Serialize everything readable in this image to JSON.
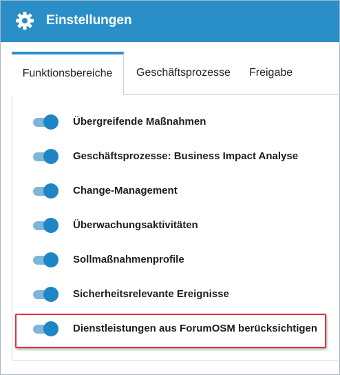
{
  "header": {
    "title": "Einstellungen",
    "icon": "gear-icon",
    "color": "#2a8fc9"
  },
  "tabs": [
    {
      "label": "Funktionsbereiche",
      "active": true
    },
    {
      "label": "Geschäftsprozesse",
      "active": false
    },
    {
      "label": "Freigabe",
      "active": false
    }
  ],
  "settings": [
    {
      "label": "Übergreifende Maßnahmen",
      "enabled": true
    },
    {
      "label": "Geschäftsprozesse: Business Impact Analyse",
      "enabled": true
    },
    {
      "label": "Change-Management",
      "enabled": true
    },
    {
      "label": "Überwachungsaktivitäten",
      "enabled": true
    },
    {
      "label": "Sollmaßnahmenprofile",
      "enabled": true
    },
    {
      "label": "Sicherheitsrelevante Ereignisse",
      "enabled": true
    },
    {
      "label": "Dienstleistungen aus ForumOSM berücksichtigen",
      "enabled": true,
      "highlighted": true
    }
  ],
  "colors": {
    "accent": "#1f86c6",
    "highlight": "#d9343d"
  }
}
